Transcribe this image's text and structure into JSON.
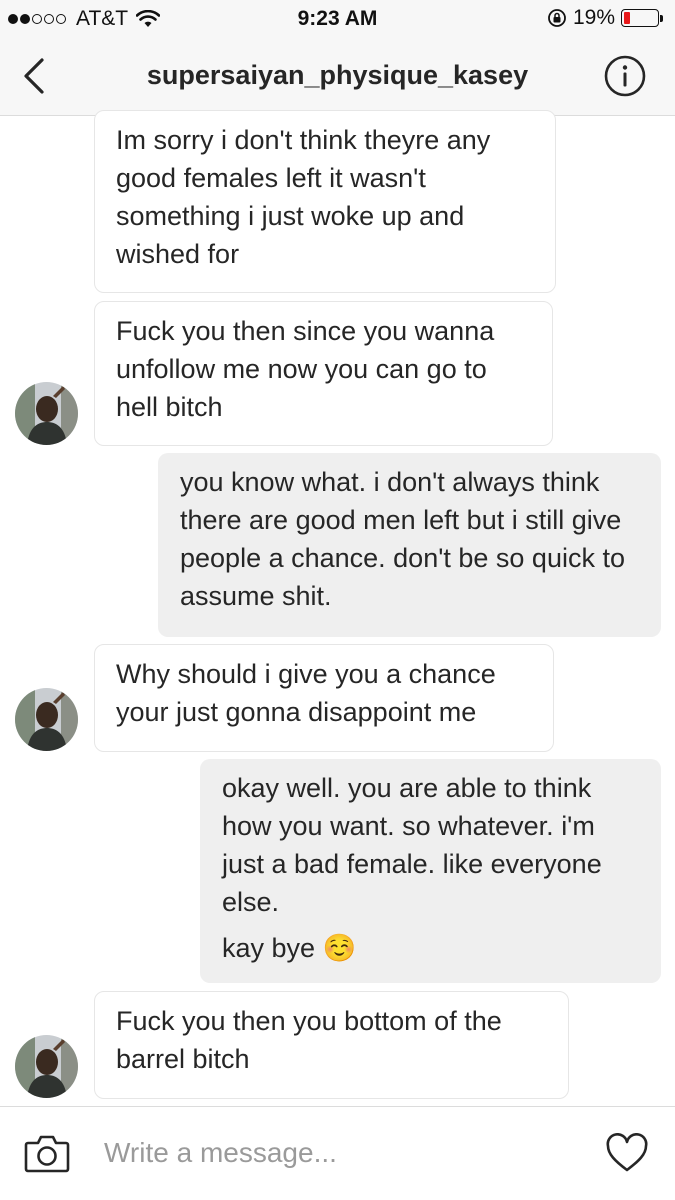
{
  "status_bar": {
    "carrier": "AT&T",
    "time": "9:23 AM",
    "battery_percent": "19%",
    "battery_level": 0.19,
    "signal_bars_filled": 2,
    "signal_bars_total": 5,
    "battery_color": "#e8191a"
  },
  "header": {
    "title": "supersaiyan_physique_kasey",
    "back_icon": "chevron-left-icon",
    "info_icon": "info-icon"
  },
  "messages": [
    {
      "direction": "received",
      "lines": [
        "Im sorry i don't think theyre any good females left it wasn't something i just woke up and wished for"
      ],
      "avatar": false
    },
    {
      "direction": "received",
      "lines": [
        "Fuck you then since you wanna unfollow me now you can go to hell bitch"
      ],
      "avatar": true
    },
    {
      "direction": "sent",
      "lines": [
        "you know what. i don't always think there are good men left but i still give people a chance. don't be so quick to assume shit."
      ]
    },
    {
      "direction": "received",
      "lines": [
        "Why should i give you a chance your just gonna disappoint me"
      ],
      "avatar": true
    },
    {
      "direction": "sent",
      "lines": [
        "okay well. you are able to think how you want. so whatever. i'm just a bad female. like everyone else.",
        "kay bye ☺️"
      ]
    },
    {
      "direction": "received",
      "lines": [
        "Fuck you then you bottom of the barrel bitch"
      ],
      "avatar": true
    }
  ],
  "composer": {
    "placeholder": "Write a message...",
    "camera_icon": "camera-icon",
    "heart_icon": "heart-icon"
  },
  "colors": {
    "sent_bubble": "#efefef",
    "received_border": "#e6e6e6",
    "header_bg": "#f7f7f7"
  }
}
